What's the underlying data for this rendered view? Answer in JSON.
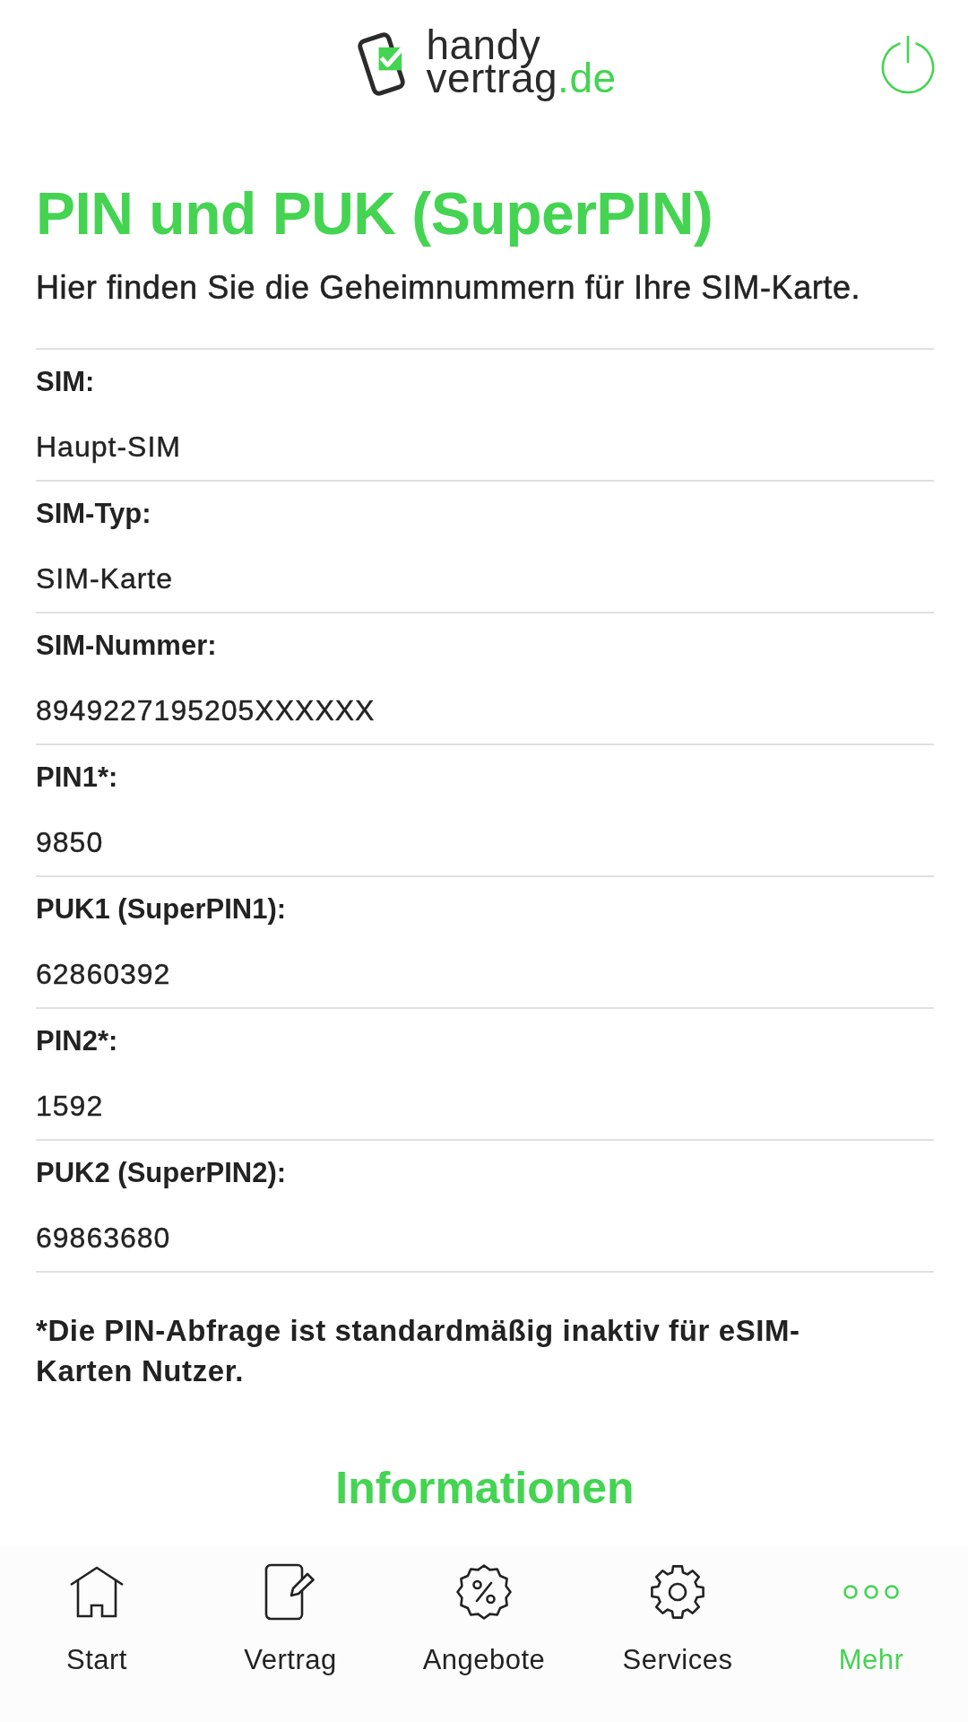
{
  "header": {
    "logo": {
      "line_1": "handy",
      "line_2": "vertrag",
      "suffix": ".de"
    }
  },
  "page": {
    "title": "PIN und PUK (SuperPIN)",
    "subtitle": "Hier finden Sie die Geheimnummern für Ihre SIM-Karte."
  },
  "fields": [
    {
      "label": "SIM:",
      "value": "Haupt-SIM"
    },
    {
      "label": "SIM-Typ:",
      "value": "SIM-Karte"
    },
    {
      "label": "SIM-Nummer:",
      "value": "8949227195205XXXXXX"
    },
    {
      "label": "PIN1*:",
      "value": "9850"
    },
    {
      "label": "PUK1 (SuperPIN1):",
      "value": "62860392"
    },
    {
      "label": "PIN2*:",
      "value": "1592"
    },
    {
      "label": "PUK2 (SuperPIN2):",
      "value": "69863680"
    }
  ],
  "footnote": "*Die PIN-Abfrage ist standardmäßig inaktiv für eSIM-Karten Nutzer.",
  "section_heading": "Informationen",
  "tab_bar": {
    "items": [
      {
        "label": "Start",
        "selected": false
      },
      {
        "label": "Vertrag",
        "selected": false
      },
      {
        "label": "Angebote",
        "selected": false
      },
      {
        "label": "Services",
        "selected": false
      },
      {
        "label": "Mehr",
        "selected": true
      }
    ]
  }
}
